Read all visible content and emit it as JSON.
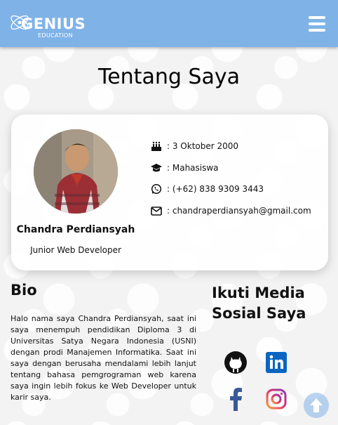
{
  "navbar": {
    "logo_text": "GENIUS",
    "logo_subtext": "EDUCATION",
    "menu_icon": "hamburger-icon"
  },
  "page": {
    "title": "Tentang Saya"
  },
  "profile": {
    "name": "Chandra Perdiansyah",
    "role": "Junior Web Developer",
    "info": [
      {
        "icon": "birthday-cake-icon",
        "text": ": 3 Oktober 2000"
      },
      {
        "icon": "graduation-cap-icon",
        "text": ": Mahasiswa"
      },
      {
        "icon": "whatsapp-icon",
        "text": ": (+62) 838 9309 3443"
      },
      {
        "icon": "envelope-icon",
        "text": ": chandraperdiansyah@gmail.com"
      }
    ]
  },
  "bio": {
    "title": "Bio",
    "text": "Halo nama saya Chandra Perdiansyah, saat ini saya menempuh pendidikan Diploma 3 di Universitas Satya Negara Indonesia (USNI) dengan prodi Manajemen Informatika. Saat ini saya dengan berusaha mendalami lebih lanjut tentang bahasa pemgrograman web karena saya ingin lebih fokus ke Web Developer untuk karir saya."
  },
  "social": {
    "title": "Ikuti Media Sosial Saya",
    "links": [
      {
        "icon": "github-icon"
      },
      {
        "icon": "linkedin-icon"
      },
      {
        "icon": "facebook-icon"
      },
      {
        "icon": "instagram-icon"
      }
    ]
  },
  "colors": {
    "navbar": "#7fb3e8",
    "linkedin": "#0a66c2",
    "facebook": "#3b5998"
  }
}
